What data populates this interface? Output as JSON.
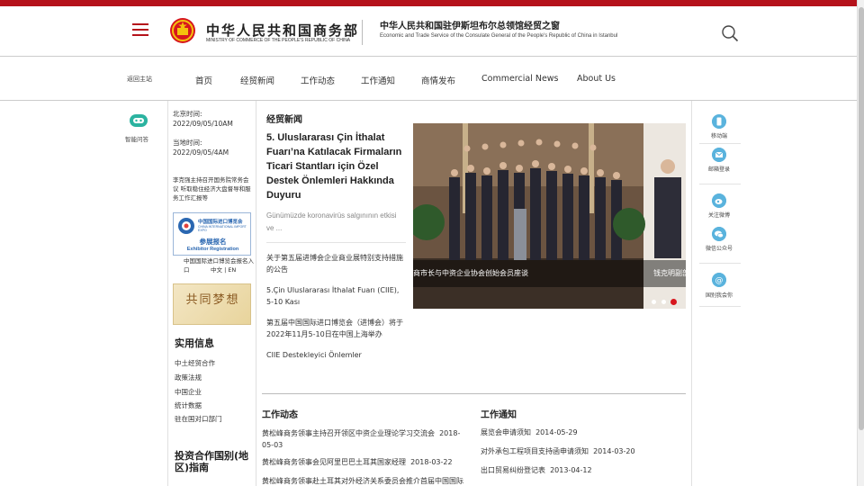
{
  "header": {
    "logo_cn": "中华人民共和国商务部",
    "logo_en": "MINISTRY OF COMMERCE OF THE PEOPLE'S REPUBLIC OF CHINA",
    "site_title_cn": "中华人民共和国驻伊斯坦布尔总领馆经贸之窗",
    "site_title_en": "Economic and Trade Service of the Consulate General of the People's Republic of China in Istanbul"
  },
  "nav": {
    "home_link": "返回主站",
    "items": [
      "首页",
      "经贸新闻",
      "工作动态",
      "工作通知",
      "商情发布",
      "Commercial News",
      "About Us"
    ]
  },
  "left_rail": {
    "assistant_label": "智能问答"
  },
  "side": {
    "beijing_label": "北京时间:",
    "beijing_time": "2022/09/05/10AM",
    "local_label": "当地时间:",
    "local_time": "2022/09/05/4AM",
    "premier_news": "李克强主持召开国务院常务会议 听取稳住经济大盘督导和服务工作汇报等",
    "ciie_cn": "中国国际进口博览会",
    "ciie_en": "CHINA INTERNATIONAL IMPORT EXPO",
    "ciie_reg_cn": "参展报名",
    "ciie_reg_en": "Exhibitor Registration",
    "ciie_caption": "中国国际进口博览会报名入口",
    "lang_links": "中文 | EN",
    "dream_text": "共同梦想",
    "useful_title": "实用信息",
    "useful_links": [
      "中土经贸合作",
      "政策法规",
      "中国企业",
      "统计数据",
      "驻在国对口部门"
    ],
    "invest_title": "投资合作国别(地区)指南"
  },
  "main": {
    "news_title": "经贸新闻",
    "headline": "5. Uluslararası Çin İthalat Fuarı’na Katılacak Firmaların Ticari Stantları için Özel Destek Önlemleri Hakkında Duyuru",
    "excerpt": "Günümüzde koronavirüs salgınının etkisi ve ...",
    "links": [
      "关于第五届进博会企业商业展特别支持措施的公告",
      "5.Çin Uluslararası İthalat Fuarı (CIIE), 5-10 Kası",
      "第五届中国国际进口博览会（进博会）将于2022年11月5-10日在中国上海举办",
      "CIIE Destekleyici Önlemler"
    ],
    "carousel_caption_1": "商市长与中资企业协会创始会员座谈",
    "carousel_caption_2": "钱克明副部",
    "work_news_title": "工作动态",
    "work_news": [
      {
        "text": "黄松峰商务领事主持召开领区中资企业理论学习交流会",
        "date": "2018-05-03"
      },
      {
        "text": "黄松峰商务领事会见阿里巴巴土耳其国家经理",
        "date": "2018-03-22"
      },
      {
        "text": "黄松峰商务领事赴土耳其对外经济关系委员会推介首届中国国际"
      }
    ],
    "notices_title": "工作通知",
    "notices": [
      {
        "text": "展览会申请须知",
        "date": "2014-05-29"
      },
      {
        "text": "对外承包工程项目支持函申请须知",
        "date": "2014-03-20"
      },
      {
        "text": "出口贸易纠纷登记表",
        "date": "2013-04-12"
      }
    ]
  },
  "right_rail": {
    "items": [
      "移动端",
      "邮箱登录",
      "关注微博",
      "微信公众号",
      "国别我会你"
    ]
  },
  "colors": {
    "brand_red": "#b5121b",
    "icon_blue": "#5ab3dd"
  }
}
